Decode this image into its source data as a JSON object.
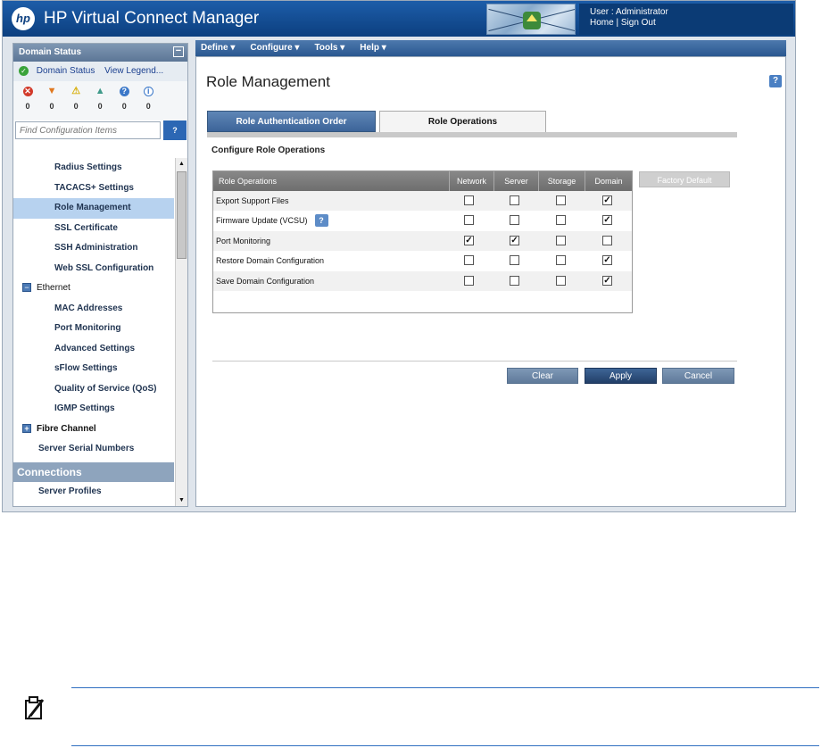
{
  "header": {
    "app_title": "HP Virtual Connect Manager",
    "logo_text": "hp",
    "user_label": "User : Administrator",
    "home_link": "Home",
    "separator": "|",
    "signout_link": "Sign Out"
  },
  "domain_status": {
    "header": "Domain Status",
    "collapse_glyph": "−",
    "link_status": "Domain Status",
    "link_legend": "View Legend...",
    "icons": [
      {
        "name": "critical-icon",
        "glyph": "✕",
        "color": "#d23a2a",
        "count": "0"
      },
      {
        "name": "major-icon",
        "glyph": "▼",
        "color": "#e0781f",
        "count": "0"
      },
      {
        "name": "minor-icon",
        "glyph": "⚠",
        "color": "#e8c21a",
        "count": "0"
      },
      {
        "name": "warning-icon",
        "glyph": "▲",
        "color": "#3f9a8a",
        "count": "0"
      },
      {
        "name": "unknown-icon",
        "glyph": "?",
        "color": "#3b78c9",
        "count": "0"
      },
      {
        "name": "info-icon",
        "glyph": "i",
        "color": "#3b78c9",
        "count": "0"
      }
    ]
  },
  "search": {
    "placeholder": "Find Configuration Items",
    "button_label": "?"
  },
  "nav": {
    "radius": "Radius Settings",
    "tacacs": "TACACS+ Settings",
    "role_mgmt": "Role Management",
    "ssl_cert": "SSL Certificate",
    "ssh_admin": "SSH Administration",
    "web_ssl": "Web SSL Configuration",
    "ethernet": "Ethernet",
    "mac": "MAC Addresses",
    "port_mon": "Port Monitoring",
    "adv": "Advanced Settings",
    "sflow": "sFlow Settings",
    "qos": "Quality of Service (QoS)",
    "igmp": "IGMP Settings",
    "fibre": "Fibre Channel",
    "serial": "Server Serial Numbers",
    "connections": "Connections",
    "profiles": "Server Profiles",
    "toggle_minus": "−",
    "toggle_plus": "+"
  },
  "menu": {
    "define": "Define ▾",
    "configure": "Configure ▾",
    "tools": "Tools ▾",
    "help": "Help ▾"
  },
  "page": {
    "title": "Role Management",
    "help": "?",
    "tab_auth": "Role Authentication Order",
    "tab_ops": "Role Operations",
    "section": "Configure Role Operations",
    "factory_default": "Factory Default"
  },
  "table": {
    "headers": [
      "Role Operations",
      "Network",
      "Server",
      "Storage",
      "Domain"
    ],
    "rows": [
      {
        "label": "Export Support Files",
        "network": "",
        "server": "",
        "storage": "",
        "domain": "✓"
      },
      {
        "label": "Firmware Update (VCSU)",
        "help": "?",
        "network": "",
        "server": "",
        "storage": "",
        "domain": "✓"
      },
      {
        "label": "Port Monitoring",
        "network": "✓",
        "server": "✓",
        "storage": "",
        "domain": ""
      },
      {
        "label": "Restore Domain Configuration",
        "network": "",
        "server": "",
        "storage": "",
        "domain": "✓"
      },
      {
        "label": "Save Domain Configuration",
        "network": "",
        "server": "",
        "storage": "",
        "domain": "✓"
      }
    ]
  },
  "actions": {
    "clear": "Clear",
    "apply": "Apply",
    "cancel": "Cancel"
  },
  "colors": {
    "header_blue": "#0c3f7f",
    "selected_nav": "#b7d2ef",
    "note_rule": "#2f6fc1"
  }
}
